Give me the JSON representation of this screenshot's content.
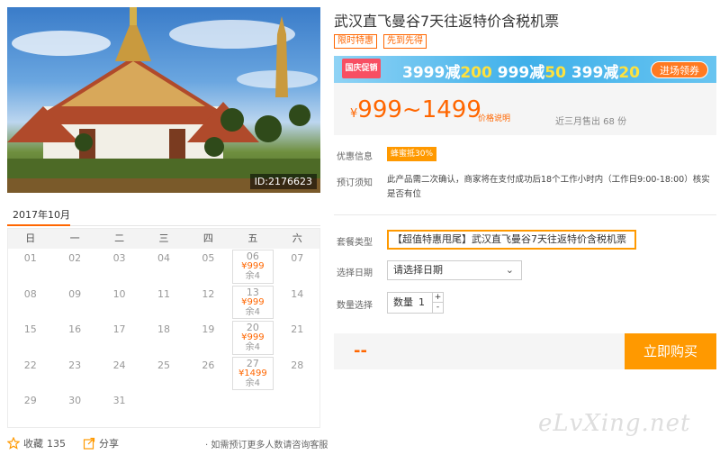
{
  "photo": {
    "id_label": "ID:2176623"
  },
  "calendar": {
    "month": "2017年10月",
    "weekdays": [
      "日",
      "一",
      "二",
      "三",
      "四",
      "五",
      "六"
    ],
    "rows": [
      [
        {
          "d": "01"
        },
        {
          "d": "02"
        },
        {
          "d": "03"
        },
        {
          "d": "04"
        },
        {
          "d": "05"
        },
        {
          "d": "06",
          "p": "¥999",
          "r": "余4"
        },
        {
          "d": "07"
        }
      ],
      [
        {
          "d": "08"
        },
        {
          "d": "09"
        },
        {
          "d": "10"
        },
        {
          "d": "11"
        },
        {
          "d": "12"
        },
        {
          "d": "13",
          "p": "¥999",
          "r": "余4"
        },
        {
          "d": "14"
        }
      ],
      [
        {
          "d": "15"
        },
        {
          "d": "16"
        },
        {
          "d": "17"
        },
        {
          "d": "18"
        },
        {
          "d": "19"
        },
        {
          "d": "20",
          "p": "¥999",
          "r": "余4"
        },
        {
          "d": "21"
        }
      ],
      [
        {
          "d": "22"
        },
        {
          "d": "23"
        },
        {
          "d": "24"
        },
        {
          "d": "25"
        },
        {
          "d": "26"
        },
        {
          "d": "27",
          "p": "¥1499",
          "r": "余4"
        },
        {
          "d": "28"
        }
      ],
      [
        {
          "d": "29"
        },
        {
          "d": "30"
        },
        {
          "d": "31"
        },
        {
          "d": ""
        },
        {
          "d": ""
        },
        {
          "d": ""
        },
        {
          "d": ""
        }
      ]
    ]
  },
  "footer": {
    "fav_label": "收藏",
    "fav_count": "135",
    "share_label": "分享",
    "tip": "· 如需预订更多人数请咨询客服"
  },
  "product": {
    "title": "武汉直飞曼谷7天往返特价含税机票",
    "tags": [
      "限时特惠",
      "先到先得"
    ]
  },
  "banner": {
    "badge": "国庆促销",
    "offer_1_base": "3999减",
    "offer_1_amount": "200",
    "offer_2_base": "999减",
    "offer_2_amount": "50",
    "offer_3_base": "399减",
    "offer_3_amount": "20",
    "button": "进场领券"
  },
  "price": {
    "currency": "¥",
    "range": "999~1499",
    "note": "价格说明",
    "sold": "近三月售出 68 份"
  },
  "info": {
    "discount_label": "优惠信息",
    "discount_tag": "蜂蜜抵30%",
    "notice_label": "预订须知",
    "notice_text": "此产品需二次确认，商家将在支付成功后18个工作小时内（工作日9:00-18:00）核实是否有位"
  },
  "form": {
    "package_label": "套餐类型",
    "package_value": "【超值特惠甩尾】武汉直飞曼谷7天往返特价含税机票",
    "date_label": "选择日期",
    "date_value": "请选择日期",
    "qty_label": "数量选择",
    "qty_prefix": "数量",
    "qty_value": "1",
    "qty_plus": "+",
    "qty_minus": "-"
  },
  "buy": {
    "price_placeholder": "--",
    "button": "立即购买"
  },
  "watermark": "eLvXing.net",
  "colors": {
    "accent": "#ff6600",
    "button": "#ff9900",
    "banner": "#3fb0ea"
  }
}
